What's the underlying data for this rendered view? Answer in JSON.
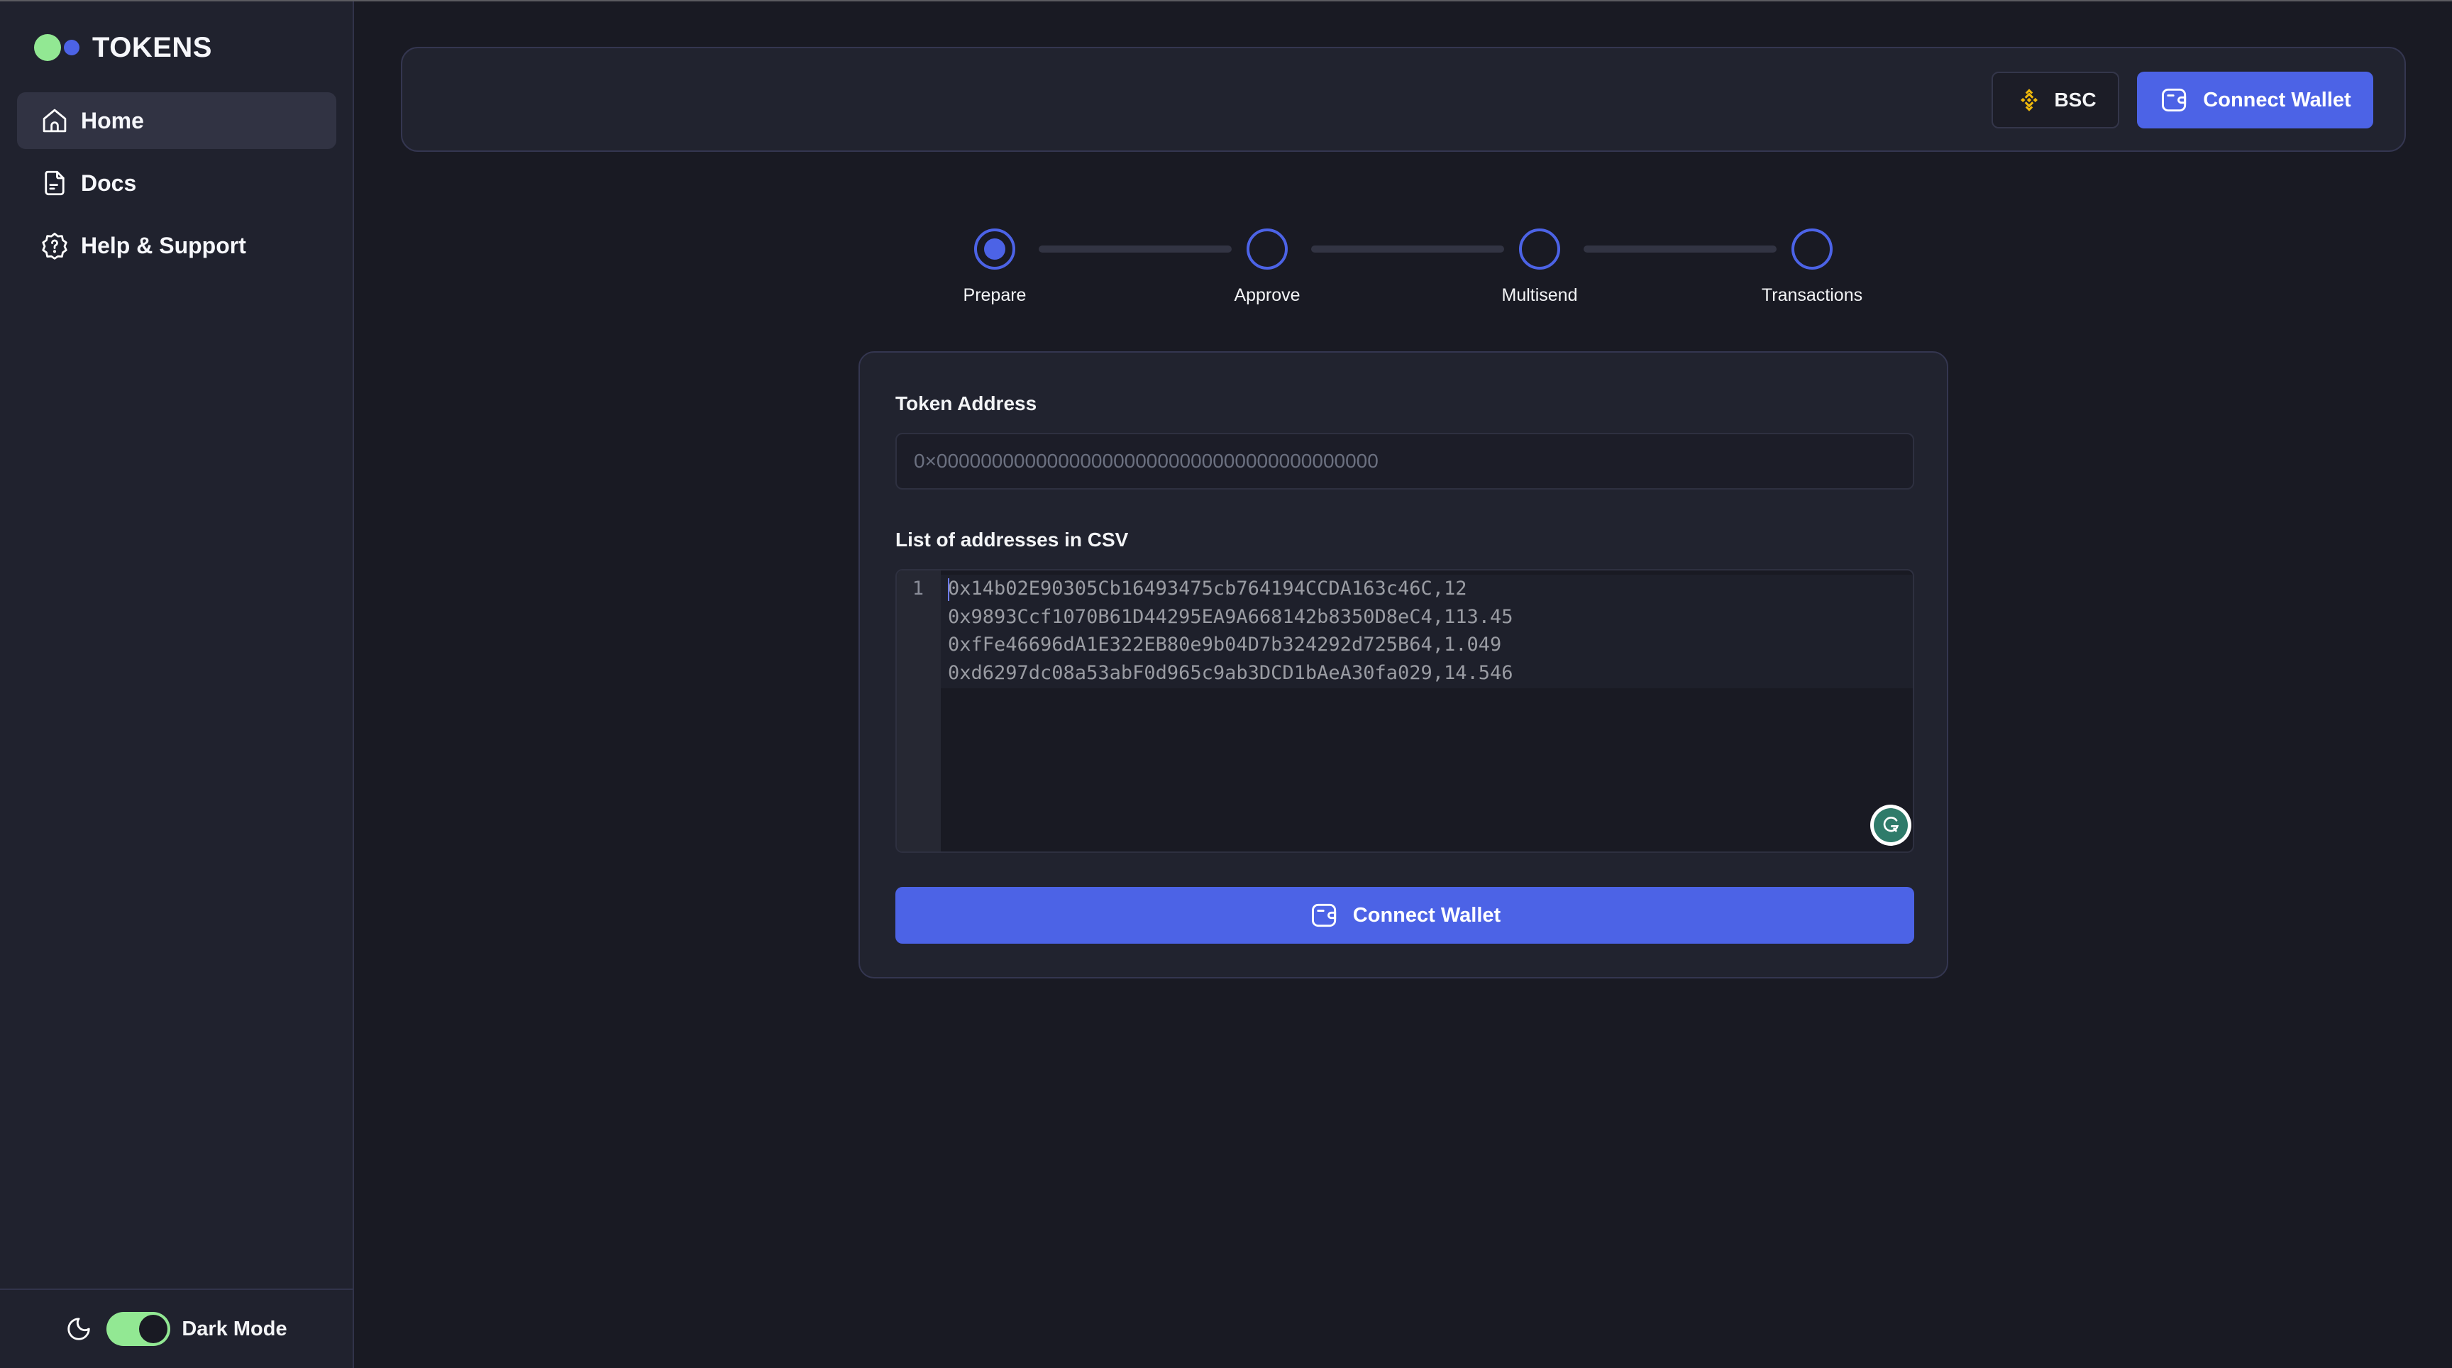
{
  "app": {
    "title": "TOKENS"
  },
  "colors": {
    "accent": "#4c63e6",
    "logo_green": "#92e893",
    "logo_blue": "#4c63e6",
    "chain_icon": "#f0b90b",
    "grammarly": "#2f7b6a"
  },
  "sidebar": {
    "items": [
      {
        "label": "Home",
        "icon": "home-icon",
        "active": true
      },
      {
        "label": "Docs",
        "icon": "document-icon",
        "active": false
      },
      {
        "label": "Help & Support",
        "icon": "help-badge-icon",
        "active": false
      }
    ],
    "dark_mode": {
      "label": "Dark Mode",
      "enabled": true,
      "icon": "moon-icon"
    }
  },
  "header": {
    "chain_button": {
      "label": "BSC",
      "icon": "binance-icon"
    },
    "connect_button": {
      "label": "Connect Wallet",
      "icon": "wallet-icon"
    }
  },
  "stepper": {
    "current_step": 1,
    "steps": [
      {
        "label": "Prepare"
      },
      {
        "label": "Approve"
      },
      {
        "label": "Multisend"
      },
      {
        "label": "Transactions"
      }
    ]
  },
  "form": {
    "token_address": {
      "label": "Token Address",
      "value": "",
      "placeholder": "0×0000000000000000000000000000000000000000"
    },
    "csv": {
      "label": "List of addresses in CSV",
      "line_numbers": [
        "1"
      ],
      "lines": [
        "0x14b02E90305Cb16493475cb764194CCDA163c46C,12",
        "0x9893Ccf1070B61D44295EA9A668142b8350D8eC4,113.45",
        "0xfFe46696dA1E322EB80e9b04D7b324292d725B64,1.049",
        "0xd6297dc08a53abF0d965c9ab3DCD1bAeA30fa029,14.546"
      ]
    },
    "submit_button": {
      "label": "Connect Wallet",
      "icon": "wallet-icon"
    }
  }
}
